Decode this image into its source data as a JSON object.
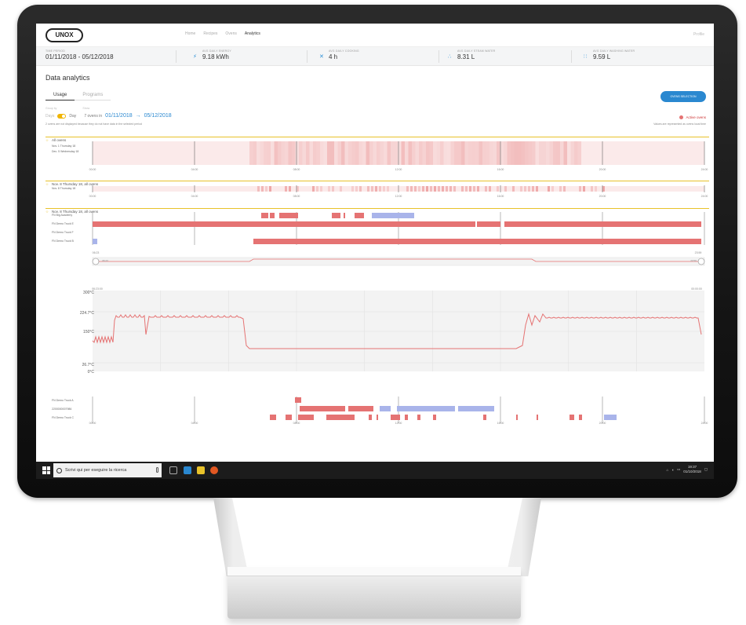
{
  "app": {
    "logo": "UNOX",
    "nav": [
      "Home",
      "Recipes",
      "Ovens",
      "Analytics"
    ],
    "nav_active": "Analytics",
    "profile": "Profile"
  },
  "stats": [
    {
      "label": "Time period",
      "value": "01/11/2018 - 05/12/2018",
      "icon": ""
    },
    {
      "label": "Avg daily energy",
      "value": "9.18 kWh",
      "icon": "lightning-icon"
    },
    {
      "label": "Avg daily cooking",
      "value": "4 h",
      "icon": "utensils-icon"
    },
    {
      "label": "Avg daily steam water",
      "value": "8.31 L",
      "icon": "water-drops-icon"
    },
    {
      "label": "Avg daily washing water",
      "value": "9.59 L",
      "icon": "washing-icon"
    }
  ],
  "page": {
    "title": "Data analytics",
    "tabs": [
      "Usage",
      "Programs"
    ],
    "ovens_button": "Ovens selection",
    "group_by_label": "Group by",
    "show_label": "Show",
    "group_opt_a": "Days",
    "group_opt_b": "Day",
    "ovens_count": "7 ovens in",
    "date_from": "01/11/2018",
    "date_to": "05/12/2018",
    "note": "2 ovens are not displayed because they do not have data in the selected period",
    "legend_label": "Active ovens",
    "legend_note": "Values are represented as ovens local time"
  },
  "sections": [
    {
      "title": "All ovens"
    },
    {
      "title": "Nov. 8 Thursday 18, all ovens"
    },
    {
      "title": "Nov. 8 Thursday 18, all ovens"
    }
  ],
  "heatmap1_rows": [
    "Nov. 1 Thursday 18",
    "Dec. 5 Wednesday 18"
  ],
  "heatmap2_rows": [
    "Nov. 8 Thursday 18"
  ],
  "ovens_rows": [
    "FN Big Academy",
    "FN Demo Truck E",
    "FN Demo Truck F",
    "FN Demo Truck B"
  ],
  "hour_ticks": [
    "00:00",
    "04:00",
    "08:00",
    "12:00",
    "16:00",
    "20:00",
    "24:00"
  ],
  "range": {
    "start": "06:23",
    "end": "23:59",
    "start_handle": "06:23",
    "end_handle": "23:59"
  },
  "temp_chart": {
    "range_start": "06:23:00",
    "range_end": "00:00:00",
    "y_labels": [
      "300°C",
      "224.7°C",
      "150°C",
      "26.7°C",
      "0°C"
    ]
  },
  "bottom_rows": [
    "FN Demo Truck A",
    "2200000007986",
    "FN Demo Truck C"
  ],
  "taskbar": {
    "search_placeholder": "Scrivi qui per eseguire la ricerca",
    "time": "19:37",
    "date": "01/10/2018"
  },
  "colors": {
    "active": "#e57373",
    "idle": "#a9b4ea",
    "accent": "#2a88d0",
    "section_line": "#e8c22a"
  }
}
